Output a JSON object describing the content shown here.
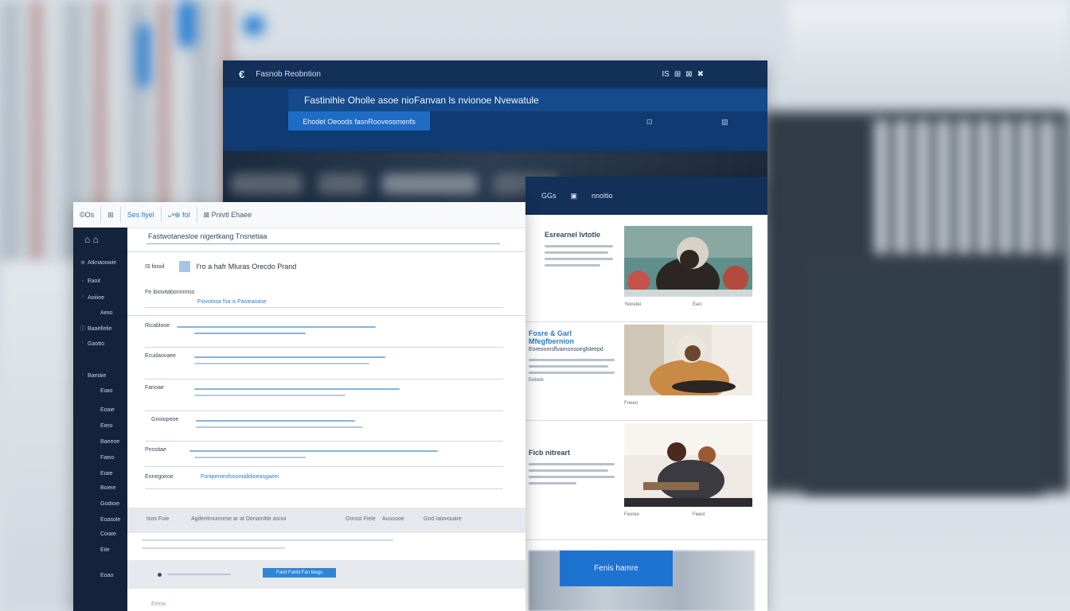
{
  "back_window": {
    "logo": "€",
    "title": "Fasnob Reobntion",
    "icons": [
      "IS",
      "⊞",
      "⊠",
      "✖"
    ],
    "banner": "Fastinihle Oholle asoe nioFanvan ls nvionoe Nvewatule",
    "cta_label": "Ehodet Oeoods fasnRoovessmenfs",
    "icon_a": "⊡",
    "icon_b": "▨"
  },
  "right_panel": {
    "header": [
      "GGs",
      "▣",
      "nnoitio"
    ],
    "cards": [
      {
        "title": "Esrearnel Ivtotle",
        "title_style": "dark",
        "meta_left": "Yeosdei",
        "meta_right": "Eaci"
      },
      {
        "title": "Fosre & Garl Mfegfbernion",
        "subtitle": "Eoreoomsflvamonsoeglsleepd",
        "title_style": "blue",
        "extra": "Eebiob",
        "meta_left": "Fneeo",
        "meta_right": ""
      },
      {
        "title": "Ficb nitreart",
        "title_style": "dark",
        "meta_left": "Feoreo",
        "meta_right": "Feeol"
      }
    ],
    "cta_label": "Fenis hamre"
  },
  "app": {
    "tabs": [
      {
        "label": "©Os",
        "active": false
      },
      {
        "label": "⊞",
        "active": false
      },
      {
        "label": "Ses fiyel",
        "active": true
      },
      {
        "label": "ᴗᵃ⊕ fol",
        "active": true
      },
      {
        "label": "⊠ Pnivtl Ehaee",
        "active": false
      }
    ],
    "sidebar": {
      "top_icons": "⌂ ⌂",
      "items": [
        {
          "bullet": "⊕",
          "label": "Atknaoowie"
        },
        {
          "bullet": "◦",
          "label": "Eaoit"
        },
        {
          "bullet": "ⁱ",
          "label": "Aoiiioe"
        },
        {
          "bullet": "",
          "label": "Aeiio"
        },
        {
          "bullet": "ⓘ",
          "label": "Baaellelie"
        },
        {
          "bullet": "ⁱ",
          "label": "Gaotto"
        },
        {
          "bullet": "ⁱ",
          "label": "Baeiaie"
        },
        {
          "bullet": "",
          "label": "Eiaio"
        },
        {
          "bullet": "",
          "label": "Eoaie"
        },
        {
          "bullet": "",
          "label": "Eieio"
        },
        {
          "bullet": "",
          "label": "Baeeoe"
        },
        {
          "bullet": "",
          "label": "Faeio"
        },
        {
          "bullet": "",
          "label": "Eiaie"
        },
        {
          "bullet": "",
          "label": "Boieie"
        },
        {
          "bullet": "",
          "label": "Godioie"
        },
        {
          "bullet": "",
          "label": "Eoasole"
        },
        {
          "bullet": "",
          "label": "Coiaie"
        },
        {
          "bullet": "",
          "label": "Eile"
        },
        {
          "bullet": "",
          "label": "Eoao"
        }
      ]
    },
    "search_value": "Fastwotanesloe nigertkang Tnsnetiaa",
    "section": {
      "prefix": "IS fossil",
      "title": "I'ro a hafr Mluras Orecdo Prand"
    },
    "rows": [
      {
        "label": "Fe ibiovitabonnnnss",
        "blue": "Fsivotosa fsa is Pasieaoase"
      },
      {
        "label": "Ricablooe",
        "blue": ""
      },
      {
        "label": "Ecudaovaee",
        "blue": ""
      },
      {
        "label": "Fanoae",
        "blue": ""
      },
      {
        "label": "Gnoiopeoe",
        "blue": ""
      },
      {
        "label": "Pnsstiae",
        "blue": ""
      },
      {
        "label": "Ennegoiroe",
        "blue": "Fonipeniesfosomalldioeasgaeei"
      }
    ],
    "grey_band": [
      "Isos Fuie",
      "Agdentmunnese ar at Denamitte asnoi",
      "Oorsst Fiele",
      "Ausoooe",
      "Gnd Iaiovouare"
    ],
    "input_button": "Fanit  Fanbi  Fan biegs",
    "bottom_note": "Eeloa"
  }
}
